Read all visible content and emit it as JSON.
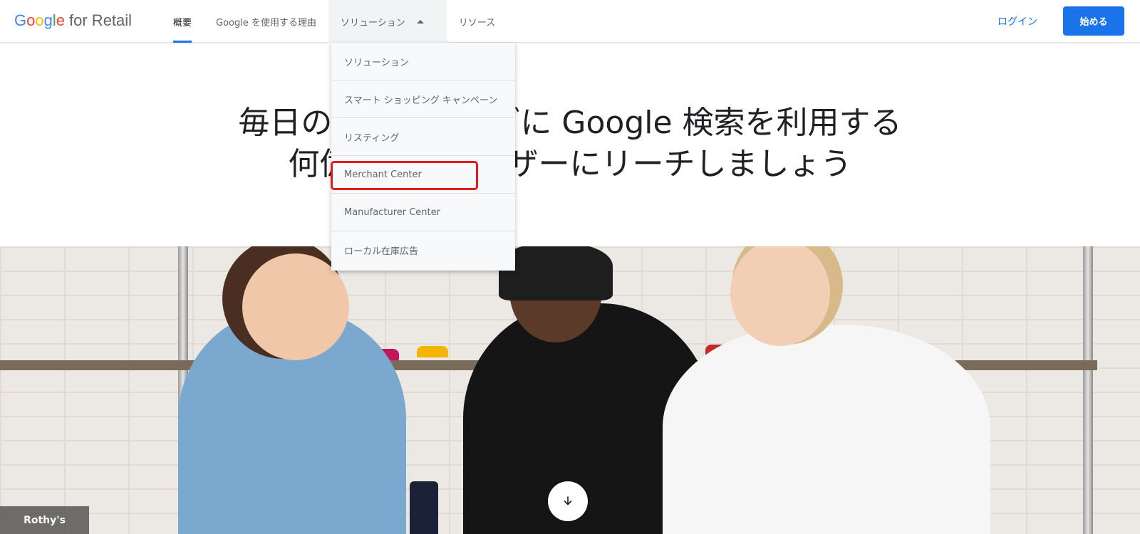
{
  "header": {
    "logo_google": "Google",
    "logo_rest": "for Retail",
    "nav": [
      {
        "label": "概要"
      },
      {
        "label": "Google を使用する理由"
      },
      {
        "label": "ソリューション"
      },
      {
        "label": "リソース"
      }
    ],
    "login_label": "ログイン",
    "start_label": "始める"
  },
  "hero": {
    "line1": "毎日のショッピングに Google 検索を利用する",
    "line2": "何億人ものユーザーにリーチしましょう"
  },
  "dropdown": {
    "items": [
      {
        "label": "ソリューション"
      },
      {
        "label": "スマート ショッピング キャンペーン"
      },
      {
        "label": "リスティング"
      },
      {
        "label": "Merchant Center"
      },
      {
        "label": "Manufacturer Center"
      },
      {
        "label": "ローカル在庫広告"
      }
    ],
    "highlighted": "Merchant Center"
  },
  "photo": {
    "caption": "Rothy's",
    "scroll_icon": "arrow-down-icon"
  },
  "colors": {
    "accent": "#1a73e8",
    "highlight": "#e31b1b",
    "dropdown_bg": "#f8f9fa"
  }
}
